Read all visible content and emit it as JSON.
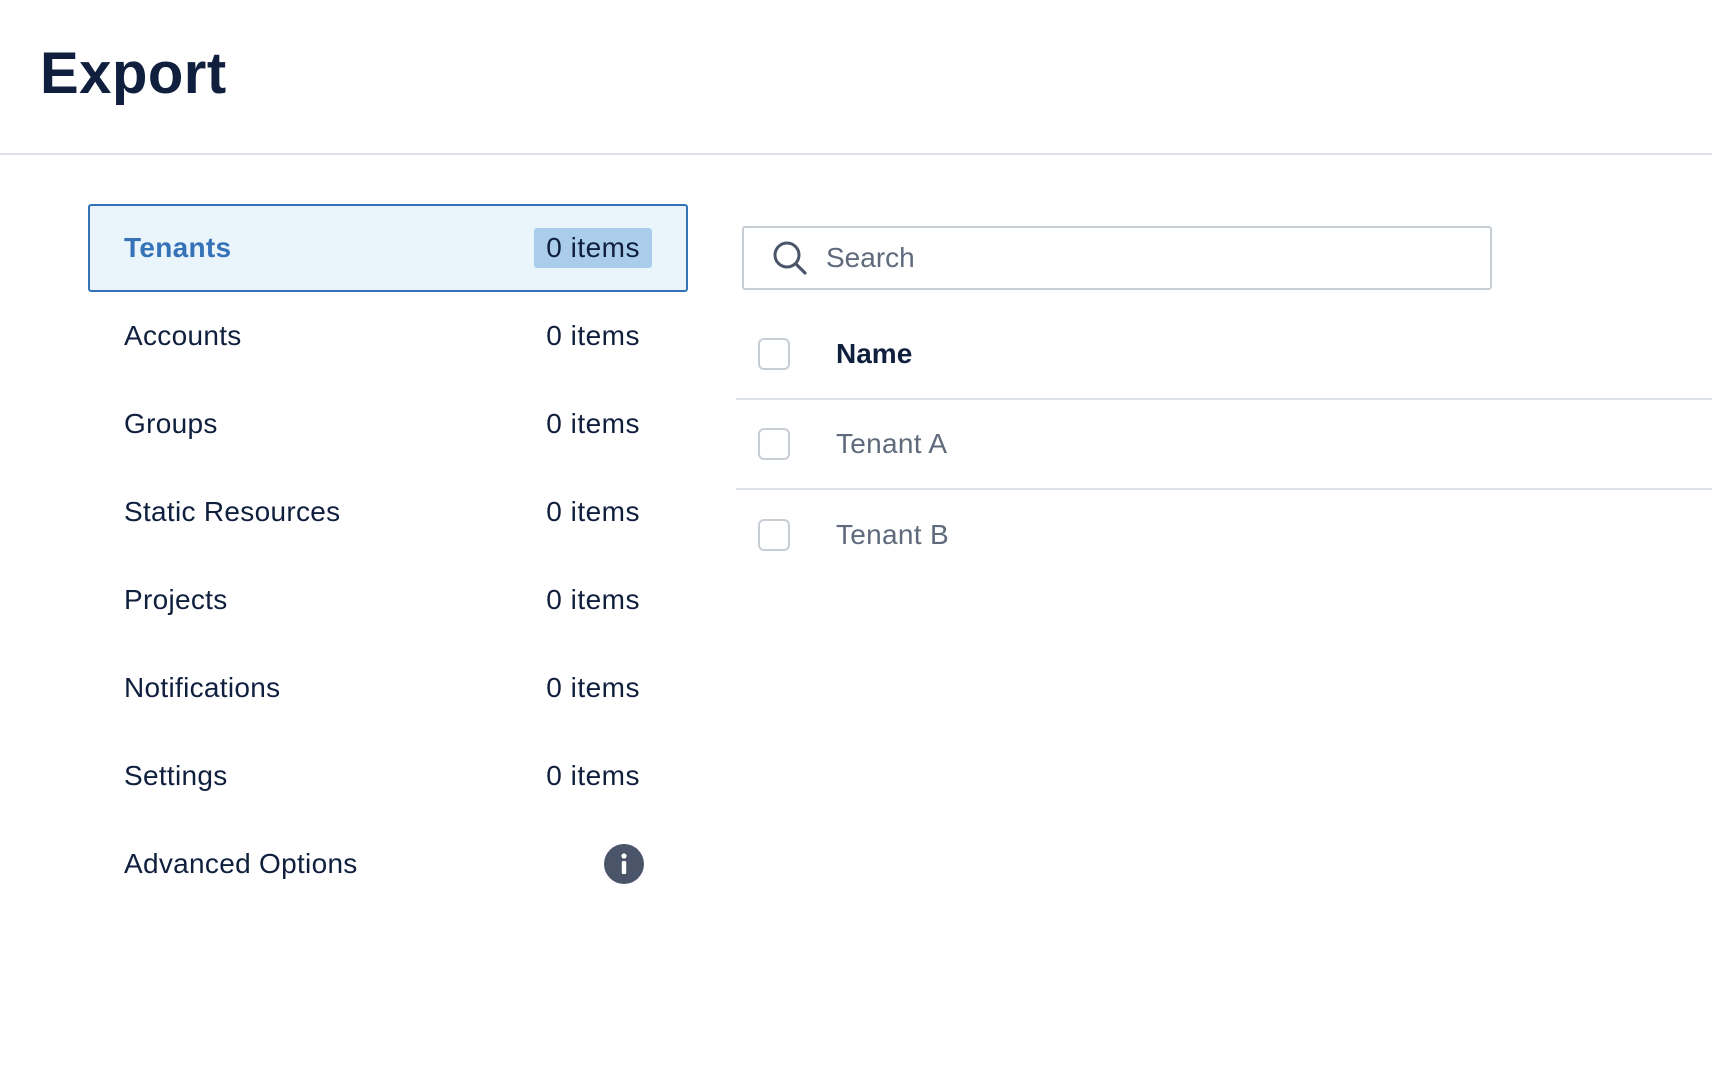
{
  "header": {
    "title": "Export"
  },
  "sidebar": {
    "items": [
      {
        "label": "Tenants",
        "count": "0 items",
        "active": true
      },
      {
        "label": "Accounts",
        "count": "0 items"
      },
      {
        "label": "Groups",
        "count": "0 items"
      },
      {
        "label": "Static Resources",
        "count": "0 items"
      },
      {
        "label": "Projects",
        "count": "0 items"
      },
      {
        "label": "Notifications",
        "count": "0 items"
      },
      {
        "label": "Settings",
        "count": "0 items"
      }
    ],
    "advanced": {
      "label": "Advanced Options",
      "icon": "info-icon"
    }
  },
  "search": {
    "placeholder": "Search",
    "value": "",
    "icon": "search-icon"
  },
  "table": {
    "columns": [
      "Name"
    ],
    "rows": [
      {
        "name": "Tenant A"
      },
      {
        "name": "Tenant B"
      }
    ]
  },
  "colors": {
    "accent": "#3572b8",
    "active_bg": "#eaf4fb",
    "badge_bg": "#a9cdea",
    "text_primary": "#0f1f3d",
    "text_muted": "#5f6b7c",
    "border": "#dde2e8"
  }
}
